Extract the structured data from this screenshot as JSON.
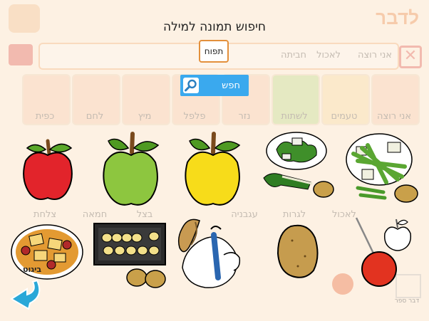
{
  "dialog": {
    "title": "חיפוש תמונה למילה",
    "search_value": "תפוח",
    "search_button_label": "חפש"
  },
  "results": [
    {
      "id": "red-apple"
    },
    {
      "id": "green-apple"
    },
    {
      "id": "yellow-apple"
    },
    {
      "id": "spinach-plate"
    },
    {
      "id": "green-beans-plate"
    },
    {
      "id": "potato-dish",
      "label": "ביגוט"
    },
    {
      "id": "potato-slices-tray"
    },
    {
      "id": "peeling-potato"
    },
    {
      "id": "potato"
    },
    {
      "id": "candy-apple"
    }
  ],
  "background_app": {
    "title": "לדבר",
    "sentence_words": [
      "אני רוצה",
      "לאכול",
      "חביתה"
    ],
    "tiles_row1": [
      "אני רוצה",
      "טעמים",
      "לשתות",
      "נזר",
      "פלפל",
      "מיץ",
      "לחם",
      "כפית"
    ],
    "tiles_row2": [
      "לאכול",
      "לגרות",
      "עגבניה",
      "בצל",
      "חמאה",
      "צלחת"
    ],
    "bottom_label": "דבר ספר"
  },
  "colors": {
    "accent_orange": "#e3903c",
    "search_button": "#3aa9ee",
    "back_arrow": "#2aa8d8"
  }
}
